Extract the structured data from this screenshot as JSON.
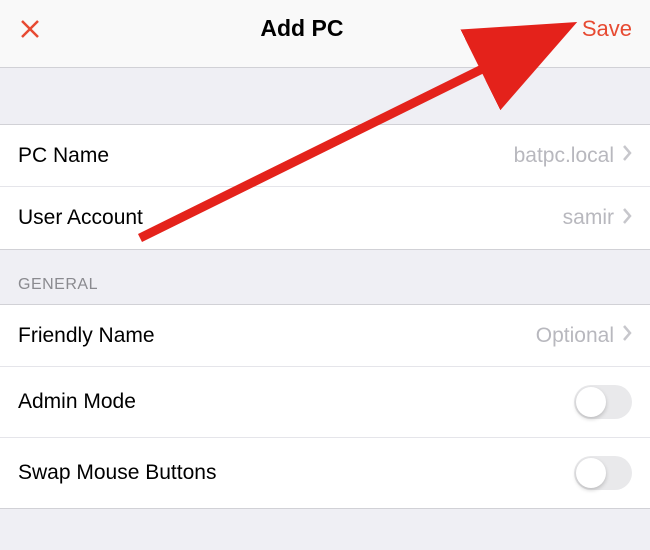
{
  "header": {
    "title": "Add PC",
    "save_label": "Save"
  },
  "top_section": {
    "rows": [
      {
        "label": "PC Name",
        "value": "batpc.local"
      },
      {
        "label": "User Account",
        "value": "samir"
      }
    ]
  },
  "general_section": {
    "header": "GENERAL",
    "rows": [
      {
        "label": "Friendly Name",
        "value": "Optional",
        "type": "nav"
      },
      {
        "label": "Admin Mode",
        "type": "toggle",
        "on": false
      },
      {
        "label": "Swap Mouse Buttons",
        "type": "toggle",
        "on": false
      }
    ]
  },
  "colors": {
    "accent": "#e74a32"
  }
}
